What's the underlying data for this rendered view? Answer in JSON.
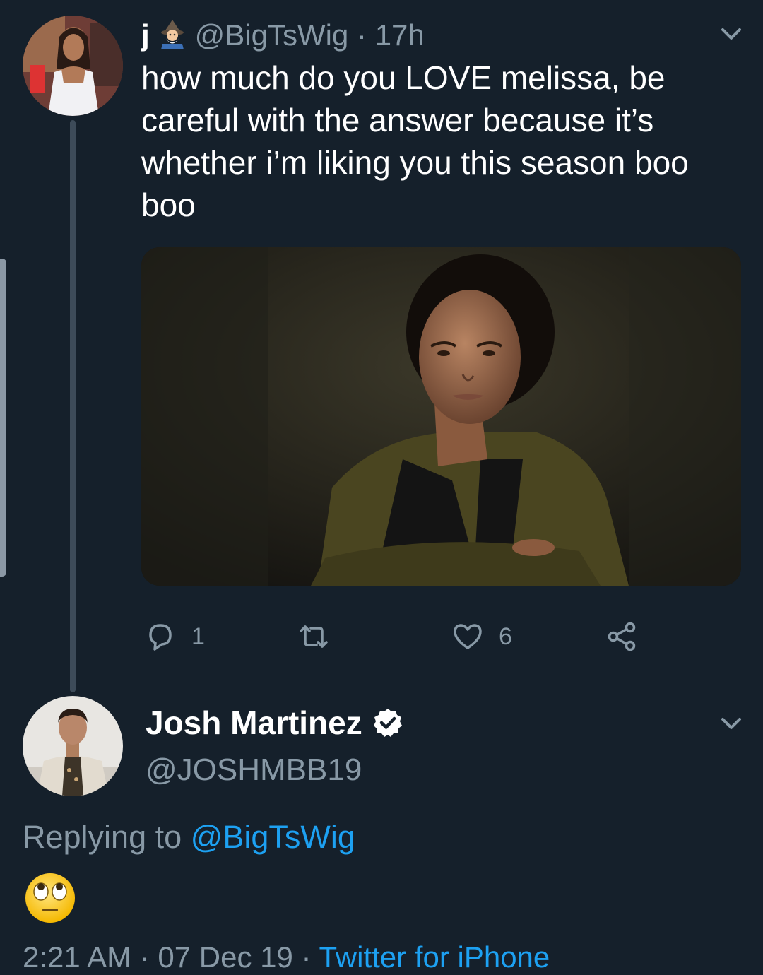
{
  "tweet": {
    "display_name": "j",
    "name_emoji_icon": "mage-emoji-icon",
    "handle": "@BigTsWig",
    "separator": "·",
    "time": "17h",
    "text": "how much do you LOVE melissa, be careful with the answer because it’s whether i’m liking you this season boo boo",
    "actions": {
      "reply_count": "1",
      "retweet_count": "",
      "like_count": "6"
    }
  },
  "reply": {
    "display_name": "Josh Martinez",
    "handle": "@JOSHMBB19",
    "verified": true,
    "replying_prefix": "Replying to ",
    "replying_to": "@BigTsWig",
    "content_emoji_icon": "face-with-rolling-eyes-icon",
    "timestamp": "2:21 AM · 07 Dec 19 · ",
    "source": "Twitter for iPhone"
  },
  "colors": {
    "background": "#15202b",
    "link": "#1da1f2",
    "secondary_text": "#8899a6"
  }
}
